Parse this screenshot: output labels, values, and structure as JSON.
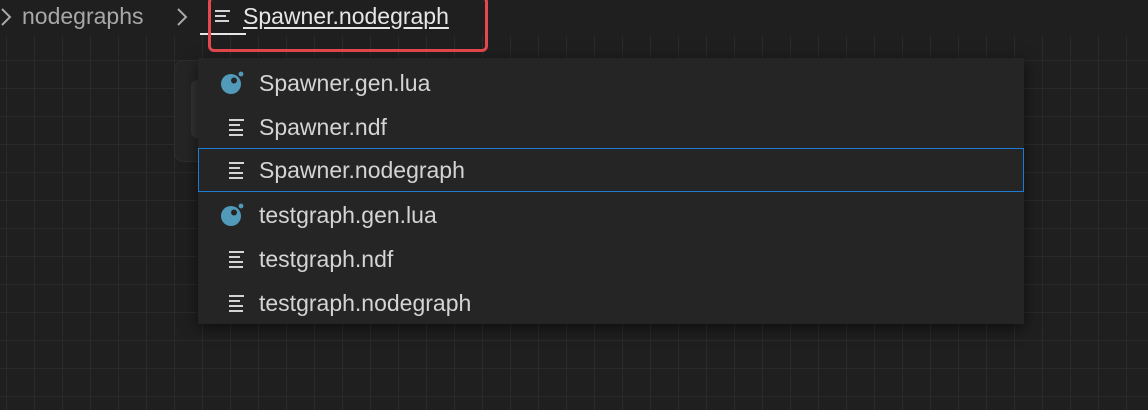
{
  "breadcrumb": {
    "folder": "nodegraphs",
    "file": "Spawner.nodegraph",
    "file_icon": "text-file-icon",
    "separator_icon": "chevron-right-icon"
  },
  "dropdown": {
    "items": [
      {
        "label": "Spawner.gen.lua",
        "icon": "lua-file-icon",
        "selected": false
      },
      {
        "label": "Spawner.ndf",
        "icon": "text-file-icon",
        "selected": false
      },
      {
        "label": "Spawner.nodegraph",
        "icon": "text-file-icon",
        "selected": true
      },
      {
        "label": "testgraph.gen.lua",
        "icon": "lua-file-icon",
        "selected": false
      },
      {
        "label": "testgraph.ndf",
        "icon": "text-file-icon",
        "selected": false
      },
      {
        "label": "testgraph.nodegraph",
        "icon": "text-file-icon",
        "selected": false
      }
    ]
  },
  "colors": {
    "highlight": "#e5484d",
    "selection_border": "#1d7bd4",
    "lua_icon": "#519aba"
  }
}
